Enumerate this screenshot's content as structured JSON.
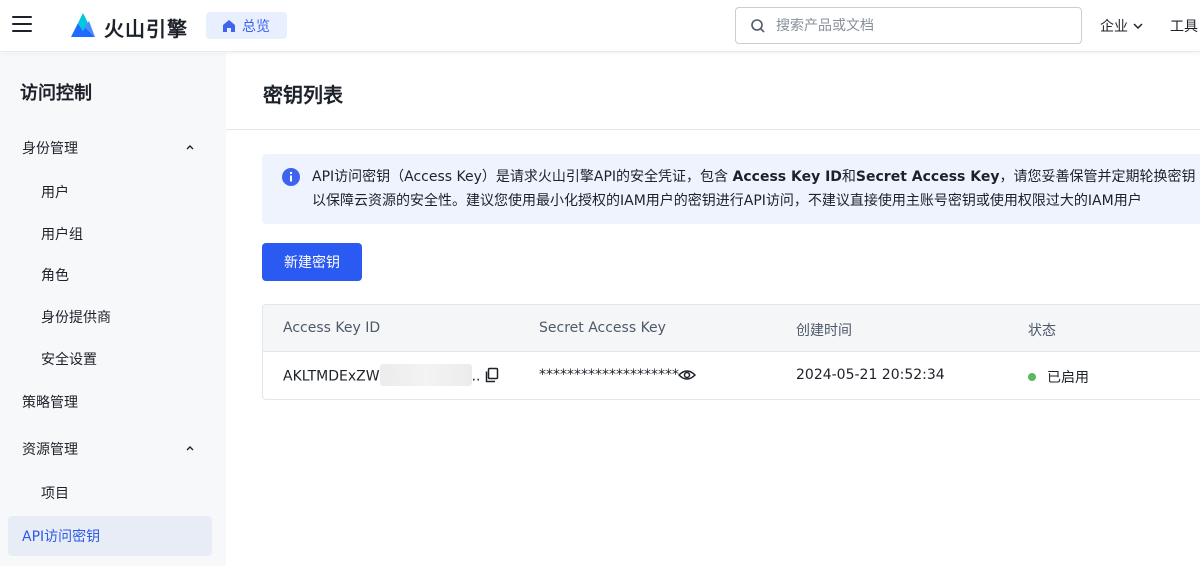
{
  "header": {
    "brand": "火山引擎",
    "home_label": "总览",
    "search_placeholder": "搜索产品或文档",
    "enterprise_label": "企业",
    "tools_label": "工具"
  },
  "sidebar": {
    "title": "访问控制",
    "items": [
      {
        "label": "身份管理"
      },
      {
        "label": "用户"
      },
      {
        "label": "用户组"
      },
      {
        "label": "角色"
      },
      {
        "label": "身份提供商"
      },
      {
        "label": "安全设置"
      },
      {
        "label": "策略管理"
      },
      {
        "label": "资源管理"
      },
      {
        "label": "项目"
      },
      {
        "label": "API访问密钥"
      }
    ]
  },
  "main": {
    "title": "密钥列表",
    "notice": {
      "line1_a": "API访问密钥（Access Key）是请求火山引擎API的安全凭证，包含 ",
      "line1_b": "Access Key ID",
      "line1_c": "和",
      "line1_d": "Secret Access Key",
      "line1_e": "，请您妥善保管并定期轮换密钥",
      "line2": "以保障云资源的安全性。建议您使用最小化授权的IAM用户的密钥进行API访问，不建议直接使用主账号密钥或使用权限过大的IAM用户"
    },
    "new_button": "新建密钥",
    "table": {
      "headers": [
        "Access Key ID",
        "Secret Access Key",
        "创建时间",
        "状态"
      ],
      "rows": [
        {
          "access_key_prefix": "AKLTMDExZW",
          "access_key_suffix": "..",
          "secret": "********************",
          "created": "2024-05-21 20:52:34",
          "status": "已启用"
        }
      ]
    }
  },
  "colors": {
    "accent": "#2b5af2",
    "status_enabled": "#5cb85c",
    "sidebar_active_bg": "#e8ecf6"
  },
  "icons": [
    "menu-icon",
    "volcano-logo",
    "home-icon",
    "search-icon",
    "chevron-down-icon",
    "chevron-up-icon",
    "info-icon",
    "copy-icon",
    "eye-icon"
  ]
}
